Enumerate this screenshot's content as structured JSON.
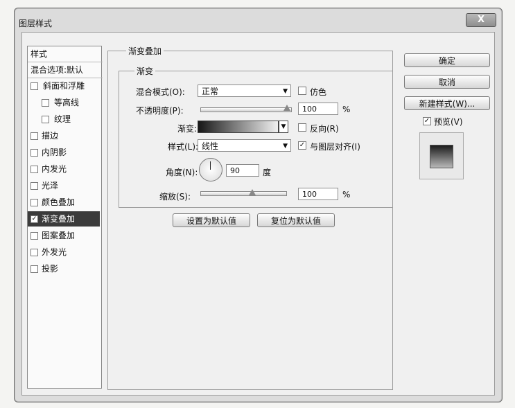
{
  "window": {
    "title": "图层样式",
    "close_symbol": "X"
  },
  "style_list": {
    "header": "样式",
    "blend_options": "混合选项:默认",
    "items": [
      {
        "label": "斜面和浮雕",
        "checked": false
      },
      {
        "label": "等高线",
        "checked": false
      },
      {
        "label": "纹理",
        "checked": false
      },
      {
        "label": "描边",
        "checked": false
      },
      {
        "label": "内阴影",
        "checked": false
      },
      {
        "label": "内发光",
        "checked": false
      },
      {
        "label": "光泽",
        "checked": false
      },
      {
        "label": "颜色叠加",
        "checked": false
      },
      {
        "label": "渐变叠加",
        "checked": true,
        "selected": true
      },
      {
        "label": "图案叠加",
        "checked": false
      },
      {
        "label": "外发光",
        "checked": false
      },
      {
        "label": "投影",
        "checked": false
      }
    ],
    "check_mark": "✓"
  },
  "panel": {
    "group_title": "渐变叠加",
    "sub_title": "渐变",
    "blend_mode_label": "混合模式(O):",
    "blend_mode_value": "正常",
    "dither_label": "仿色",
    "opacity_label": "不透明度(P):",
    "opacity_value": "100",
    "opacity_unit": "%",
    "opacity_level": 1.0,
    "gradient_label": "渐变:",
    "reverse_label": "反向(R)",
    "style_label": "样式(L):",
    "style_value": "线性",
    "align_label": "与图层对齐(I)",
    "angle_label": "角度(N):",
    "angle_value": "90",
    "angle_unit": "度",
    "scale_label": "缩放(S):",
    "scale_value": "100",
    "scale_unit": "%",
    "scale_level": 0.6,
    "reset_default_label": "设置为默认值",
    "restore_default_label": "复位为默认值"
  },
  "buttons": {
    "ok": "确定",
    "cancel": "取消",
    "new_style": "新建样式(W)...",
    "preview_label": "预览(V)"
  },
  "icons": {
    "dropdown": "▼",
    "checkbox_checked": "✓"
  }
}
